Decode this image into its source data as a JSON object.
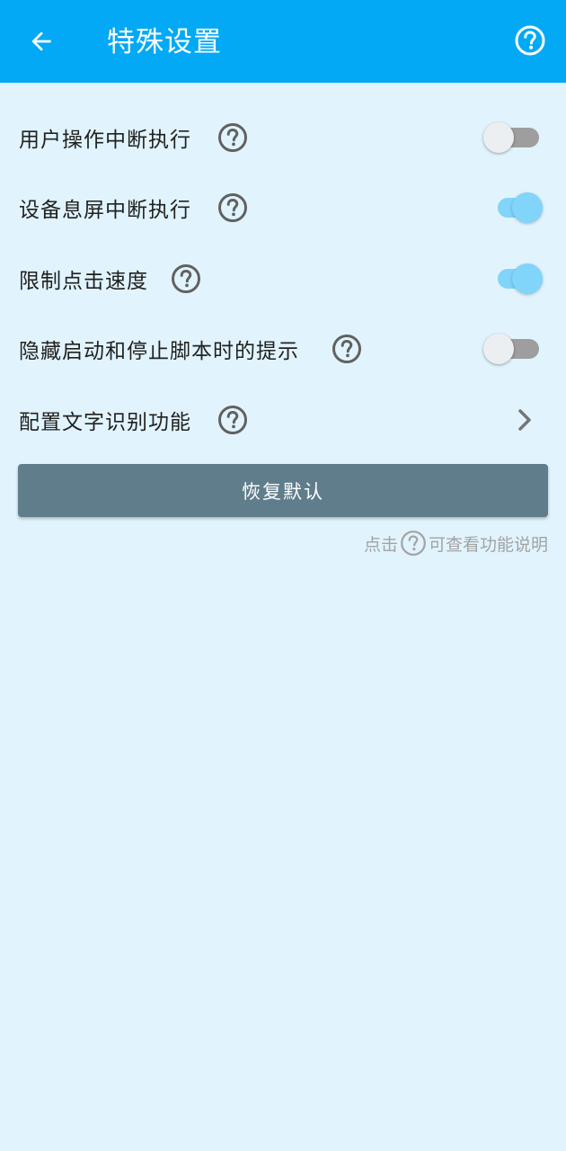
{
  "appbar": {
    "title": "特殊设置",
    "back_icon": "arrow-back-icon",
    "help_icon": "help-circle-icon",
    "color": "#03a9f4"
  },
  "settings": [
    {
      "label": "用户操作中断执行",
      "control": "switch",
      "checked": false
    },
    {
      "label": "设备息屏中断执行",
      "control": "switch",
      "checked": true
    },
    {
      "label": "限制点击速度",
      "control": "switch",
      "checked": true
    },
    {
      "label": "隐藏启动和停止脚本时的提示",
      "control": "switch",
      "checked": false
    },
    {
      "label": "配置文字识别功能",
      "control": "chevron"
    }
  ],
  "restore_button": {
    "label": "恢复默认",
    "color": "#607d8b"
  },
  "hint": {
    "prefix": "点击",
    "suffix": "可查看功能说明"
  },
  "colors": {
    "background": "#e1f4fd",
    "switch_on": "#81d4fa",
    "switch_off_track": "#9e9e9e"
  }
}
